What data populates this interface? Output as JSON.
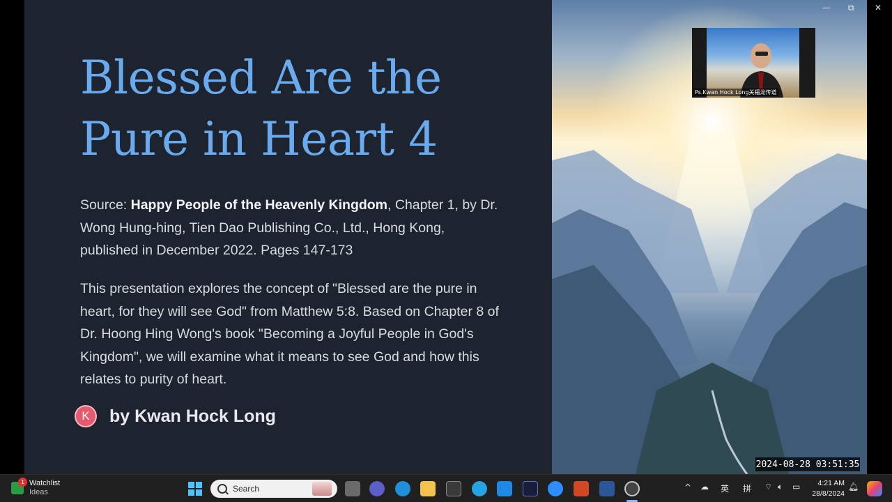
{
  "slide": {
    "title_line1": "Blessed Are the",
    "title_line2": "Pure in Heart 4",
    "source_prefix": "Source: ",
    "source_book": "Happy People of the Heavenly Kingdom",
    "source_rest": ", Chapter 1, by Dr. Wong Hung-hing, Tien Dao Publishing Co., Ltd., Hong Kong, published in December 2022. Pages 147-173",
    "description": "This presentation explores the concept of \"Blessed are the pure in heart, for they will see God\" from Matthew 5:8. Based on Chapter 8 of Dr. Hoong Hing Wong's book \"Becoming a Joyful People in God's Kingdom\", we will examine what it means to see God and how this relates to purity of heart.",
    "author_initial": "K",
    "author": "by Kwan Hock Long"
  },
  "video": {
    "participant_label": "Ps.Kwan Hock Long关福龙传道"
  },
  "recording_timestamp": "2024-08-28  03:51:35",
  "window_controls": {
    "minimize": "—",
    "restore": "⧉",
    "close": "✕"
  },
  "taskbar": {
    "widget_title": "Watchlist",
    "widget_subtitle": "Ideas",
    "widget_badge": "1",
    "search_placeholder": "Search",
    "tray_ime1": "英",
    "tray_ime2": "拼",
    "clock_time": "4:21 AM",
    "clock_date": "28/8/2024"
  },
  "colors": {
    "slide_bg": "#1e2330",
    "title": "#6aabf0",
    "avatar": "#e55a6e",
    "taskbar": "#202020"
  }
}
